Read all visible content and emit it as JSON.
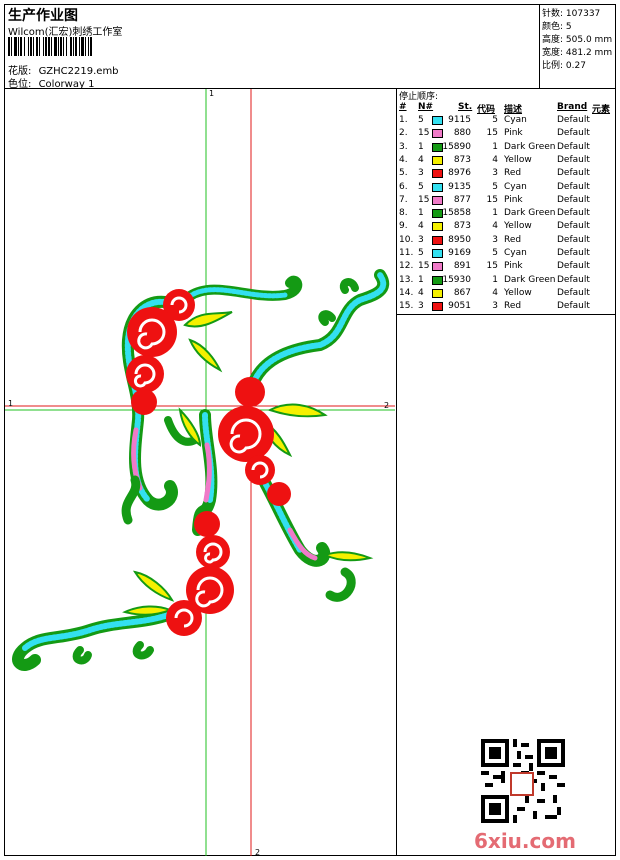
{
  "header": {
    "title": "生产作业图",
    "subtitle": "Wilcom(汇宏)刺绣工作室",
    "design_label": "花版:",
    "design_file": "GZHC2219.emb",
    "colorway_label": "色位:",
    "colorway": "Colorway 1"
  },
  "stats": {
    "stitches_label": "针数:",
    "stitches": "107337",
    "colors_label": "颜色:",
    "colors": "5",
    "height_label": "高度:",
    "height": "505.0 mm",
    "width_label": "宽度:",
    "width": "481.2 mm",
    "scale_label": "比例:",
    "scale": "0.27"
  },
  "stop_sequence": {
    "title": "停止顺序:",
    "columns": [
      "#",
      "N#",
      "St.",
      "代码",
      "描述",
      "Brand",
      "元素"
    ],
    "rows": [
      {
        "idx": "1.",
        "n": "5",
        "color": "#33e0f0",
        "st": "9115",
        "code": "5",
        "desc": "Cyan",
        "brand": "Default"
      },
      {
        "idx": "2.",
        "n": "15",
        "color": "#f07ac8",
        "st": "880",
        "code": "15",
        "desc": "Pink",
        "brand": "Default"
      },
      {
        "idx": "3.",
        "n": "1",
        "color": "#149a14",
        "st": "15890",
        "code": "1",
        "desc": "Dark Green",
        "brand": "Default"
      },
      {
        "idx": "4.",
        "n": "4",
        "color": "#f5f000",
        "st": "873",
        "code": "4",
        "desc": "Yellow",
        "brand": "Default"
      },
      {
        "idx": "5.",
        "n": "3",
        "color": "#ee1111",
        "st": "8976",
        "code": "3",
        "desc": "Red",
        "brand": "Default"
      },
      {
        "idx": "6.",
        "n": "5",
        "color": "#33e0f0",
        "st": "9135",
        "code": "5",
        "desc": "Cyan",
        "brand": "Default"
      },
      {
        "idx": "7.",
        "n": "15",
        "color": "#f07ac8",
        "st": "877",
        "code": "15",
        "desc": "Pink",
        "brand": "Default"
      },
      {
        "idx": "8.",
        "n": "1",
        "color": "#149a14",
        "st": "15858",
        "code": "1",
        "desc": "Dark Green",
        "brand": "Default"
      },
      {
        "idx": "9.",
        "n": "4",
        "color": "#f5f000",
        "st": "873",
        "code": "4",
        "desc": "Yellow",
        "brand": "Default"
      },
      {
        "idx": "10.",
        "n": "3",
        "color": "#ee1111",
        "st": "8950",
        "code": "3",
        "desc": "Red",
        "brand": "Default"
      },
      {
        "idx": "11.",
        "n": "5",
        "color": "#33e0f0",
        "st": "9169",
        "code": "5",
        "desc": "Cyan",
        "brand": "Default"
      },
      {
        "idx": "12.",
        "n": "15",
        "color": "#f07ac8",
        "st": "891",
        "code": "15",
        "desc": "Pink",
        "brand": "Default"
      },
      {
        "idx": "13.",
        "n": "1",
        "color": "#149a14",
        "st": "15930",
        "code": "1",
        "desc": "Dark Green",
        "brand": "Default"
      },
      {
        "idx": "14.",
        "n": "4",
        "color": "#f5f000",
        "st": "867",
        "code": "4",
        "desc": "Yellow",
        "brand": "Default"
      },
      {
        "idx": "15.",
        "n": "3",
        "color": "#ee1111",
        "st": "9051",
        "code": "3",
        "desc": "Red",
        "brand": "Default"
      }
    ]
  },
  "canvas": {
    "marker_green_top": "1",
    "marker_green_left": "1",
    "marker_red_right": "2",
    "marker_red_bottom": "2"
  },
  "watermark": "6xiu.com",
  "colors": {
    "green_guide": "#22c022",
    "red_guide": "#e01818",
    "dark_green": "#149a14",
    "red": "#ee1111",
    "cyan": "#33e0f0",
    "yellow": "#f5f000",
    "pink": "#f07ac8"
  }
}
